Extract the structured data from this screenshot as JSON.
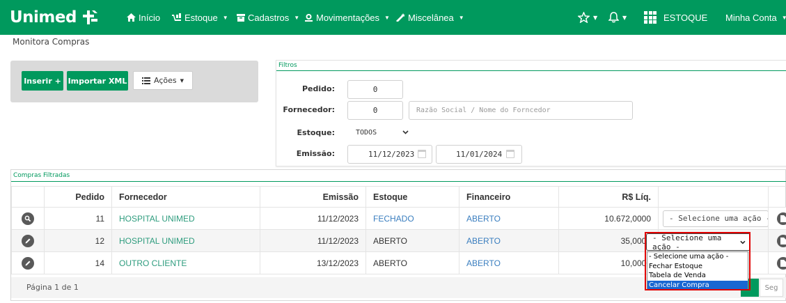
{
  "nav": {
    "brand": "Unimed",
    "inicio": "Início",
    "estoque": "Estoque",
    "cadastros": "Cadastros",
    "movimentacoes": "Movimentações",
    "miscelanea": "Miscelânea",
    "module": "ESTOQUE",
    "account": "Minha Conta"
  },
  "breadcrumb": "Monitora Compras",
  "actions": {
    "inserir": "Inserir +",
    "importar": "Importar XML",
    "acoes": "Ações"
  },
  "filters": {
    "title": "Filtros",
    "pedido_label": "Pedido:",
    "pedido_value": "0",
    "fornecedor_label": "Fornecedor:",
    "fornecedor_value": "0",
    "fornecedor_placeholder": "Razão Social / Nome do Forncedor",
    "estoque_label": "Estoque:",
    "estoque_value": "TODOS",
    "emissao_label": "Emissão:",
    "emissao_from": "11/12/2023",
    "emissao_to": "11/01/2024"
  },
  "results": {
    "title": "Compras Filtradas",
    "headers": {
      "pedido": "Pedido",
      "fornecedor": "Fornecedor",
      "emissao": "Emissão",
      "estoque": "Estoque",
      "financeiro": "Financeiro",
      "valor": "R$ Líq."
    },
    "rows": [
      {
        "icon": "search-icon",
        "pedido": "11",
        "fornecedor": "HOSPITAL UNIMED",
        "emissao": "11/12/2023",
        "estoque": "FECHADO",
        "financeiro": "ABERTO",
        "valor": "10.672,0000",
        "acao": "- Selecione uma ação -"
      },
      {
        "icon": "pencil-icon",
        "pedido": "12",
        "fornecedor": "HOSPITAL UNIMED",
        "emissao": "11/12/2023",
        "estoque": "ABERTO",
        "financeiro": "ABERTO",
        "valor": "35,0000",
        "acao": "- Selecione uma ação -"
      },
      {
        "icon": "pencil-icon",
        "pedido": "14",
        "fornecedor": "OUTRO CLIENTE",
        "emissao": "13/12/2023",
        "estoque": "ABERTO",
        "financeiro": "ABERTO",
        "valor": "10,0000",
        "acao": ""
      }
    ]
  },
  "pagination": {
    "info": "Página 1 de 1",
    "next": "Seg"
  },
  "dropdown": {
    "options": [
      "- Selecione uma ação -",
      "Fechar Estoque",
      "Tabela de Venda",
      "Cancelar Compra"
    ],
    "highlighted": 3
  },
  "colors": {
    "brand": "#00995d",
    "link": "#3a7ebf",
    "supplier": "#2e9c7e",
    "highlight_box": "#e00000",
    "dropdown_selected": "#1967d2"
  }
}
